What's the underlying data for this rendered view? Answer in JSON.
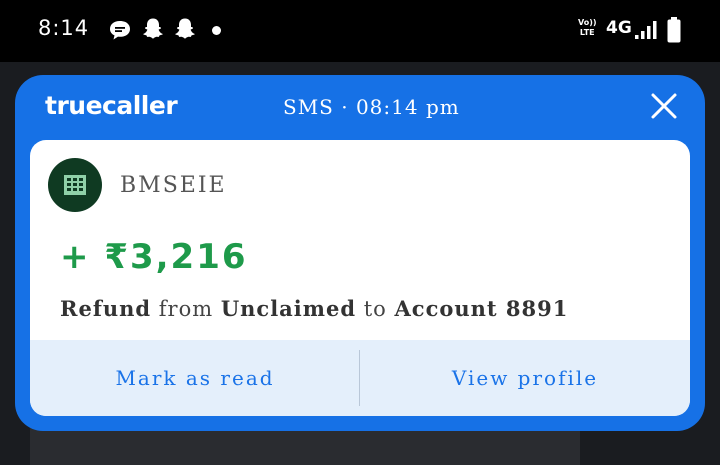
{
  "status_bar": {
    "time": "8:14",
    "network": "4G",
    "volte_top": "Vo))",
    "volte_bottom": "LTE",
    "icons": [
      "chat-bubble-icon",
      "snapchat-icon",
      "snapchat-icon",
      "dot-icon",
      "volte-icon",
      "signal-icon",
      "battery-icon"
    ]
  },
  "notification": {
    "brand": "truecaller",
    "header": "SMS · 08:14 pm",
    "sender": "BMSEIE",
    "amount": "+ ₹3,216",
    "message": {
      "w1": "Refund",
      "w2": "from",
      "w3": "Unclaimed",
      "w4": "to",
      "w5": "Account 8891"
    },
    "actions": {
      "mark_read": "Mark as read",
      "view_profile": "View profile"
    },
    "colors": {
      "card": "#1671e6",
      "amount": "#1e9a4a",
      "action_bar": "#e4effb",
      "avatar": "#0f3a22"
    }
  }
}
